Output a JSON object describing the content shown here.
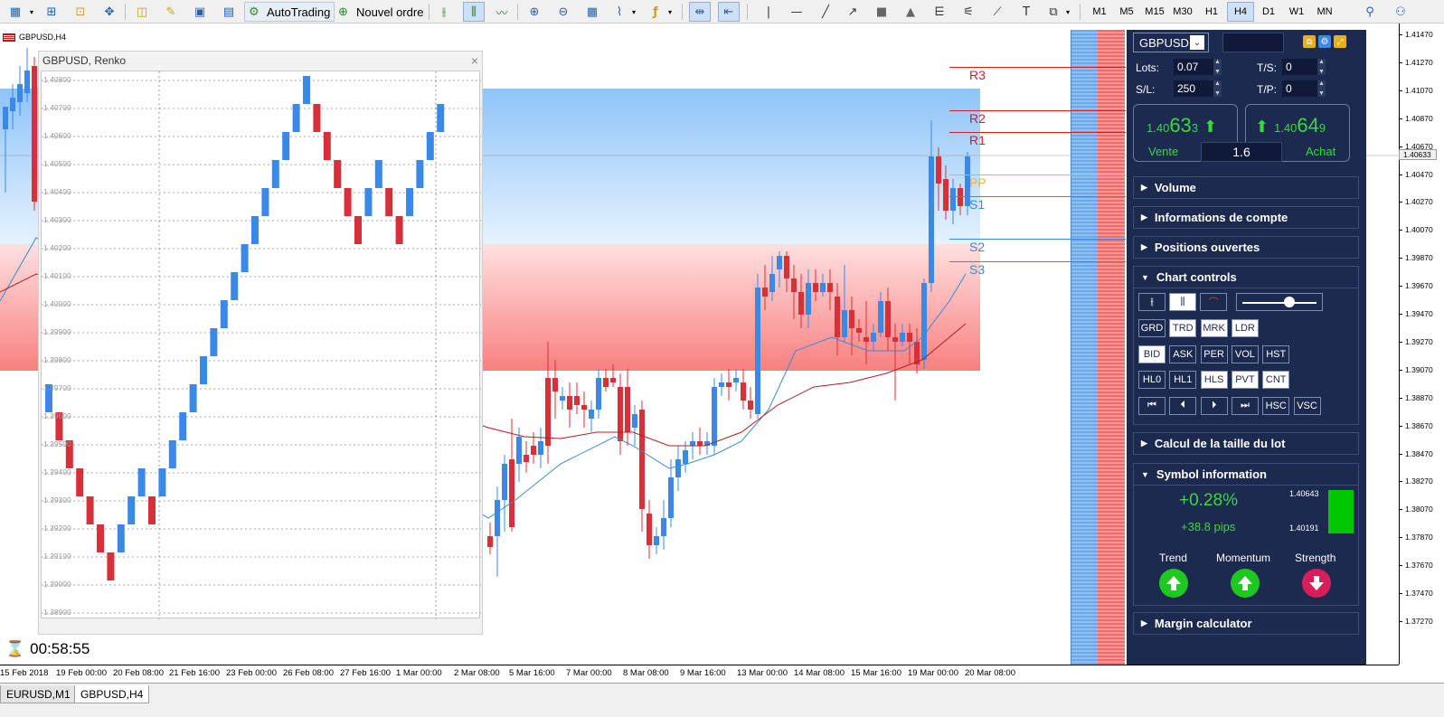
{
  "toolbar": {
    "autotrading_label": "AutoTrading",
    "new_order_label": "Nouvel ordre",
    "timeframes": [
      "M1",
      "M5",
      "M15",
      "M30",
      "H1",
      "H4",
      "D1",
      "W1",
      "MN"
    ],
    "active_timeframe": "H4"
  },
  "chart": {
    "title": "GBPUSD,H4",
    "current_price": "1.40633",
    "price_labels": [
      "1.41470",
      "1.41270",
      "1.41070",
      "1.40870",
      "1.40670",
      "1.40470",
      "1.40270",
      "1.40070",
      "1.39870",
      "1.39670",
      "1.39470",
      "1.39270",
      "1.39070",
      "1.38870",
      "1.38670",
      "1.38470",
      "1.38270",
      "1.38070",
      "1.37870",
      "1.37670",
      "1.37470",
      "1.37270"
    ],
    "time_labels": [
      "15 Feb 2018",
      "19 Feb 00:00",
      "20 Feb 08:00",
      "21 Feb 16:00",
      "23 Feb 00:00",
      "26 Feb 08:00",
      "27 Feb 16:00",
      "1 Mar 00:00",
      "2 Mar 08:00",
      "5 Mar 16:00",
      "7 Mar 00:00",
      "8 Mar 08:00",
      "9 Mar 16:00",
      "13 Mar 00:00",
      "14 Mar 08:00",
      "15 Mar 16:00",
      "19 Mar 00:00",
      "20 Mar 08:00"
    ],
    "pivots": [
      {
        "name": "R3",
        "color": "#cc2222"
      },
      {
        "name": "R2",
        "color": "#cc2222"
      },
      {
        "name": "R1",
        "color": "#cc2222"
      },
      {
        "name": "PP",
        "color": "#e8b048"
      },
      {
        "name": "S1",
        "color": "#3a88d8"
      },
      {
        "name": "S2",
        "color": "#3a88d8"
      },
      {
        "name": "S3",
        "color": "#3a88d8"
      }
    ],
    "timer": "00:58:55",
    "colors": {
      "bull": "#3a88e8",
      "bear": "#d8303a",
      "ma_fast": "#3a88d8",
      "ma_slow": "#b02020"
    }
  },
  "renko": {
    "title": "GBPUSD, Renko",
    "close_label": "×",
    "price_labels": [
      "1.40800",
      "1.40700",
      "1.40600",
      "1.40500",
      "1.40400",
      "1.40300",
      "1.40200",
      "1.40100",
      "1.40000",
      "1.39900",
      "1.39800",
      "1.39700",
      "1.39600",
      "1.39500",
      "1.39400",
      "1.39300",
      "1.39200",
      "1.39100",
      "1.39000",
      "1.38900"
    ]
  },
  "tabs": [
    "EURUSD,M1",
    "GBPUSD,H4"
  ],
  "active_tab": "GBPUSD,H4",
  "panel": {
    "symbol": "GBPUSD",
    "lots_label": "Lots:",
    "lots_value": "0.07",
    "sl_label": "S/L:",
    "sl_value": "250",
    "ts_label": "T/S:",
    "ts_value": "0",
    "tp_label": "T/P:",
    "tp_value": "0",
    "sell_price_prefix": "1.40",
    "sell_price_big": "63",
    "sell_price_small": "3",
    "buy_price_prefix": "1.40",
    "buy_price_big": "64",
    "buy_price_small": "9",
    "sell_label": "Vente",
    "buy_label": "Achat",
    "spread": "1.6",
    "sections": {
      "volume": "Volume",
      "account": "Informations de compte",
      "positions": "Positions ouvertes",
      "chart_controls": "Chart controls",
      "lot_calc": "Calcul de la taille du lot",
      "symbol_info": "Symbol information",
      "margin": "Margin calculator"
    },
    "control_rows": [
      [
        "GRD",
        "TRD",
        "MRK",
        "LDR"
      ],
      [
        "BID",
        "ASK",
        "PER",
        "VOL",
        "HST"
      ],
      [
        "HL0",
        "HL1",
        "HLS",
        "PVT",
        "CNT"
      ],
      [
        "⏮",
        "⏴",
        "⏵",
        "⏭",
        "HSC",
        "VSC"
      ]
    ],
    "active_controls": [
      "TRD",
      "MRK",
      "LDR",
      "BID",
      "HLS",
      "PVT",
      "CNT"
    ],
    "symbol_info": {
      "change_pct": "+0.28%",
      "change_pips": "+38.8 pips",
      "high": "1.40643",
      "low": "1.40191",
      "trend_label": "Trend",
      "momentum_label": "Momentum",
      "strength_label": "Strength",
      "trend_dir": "up",
      "momentum_dir": "up",
      "strength_dir": "down"
    }
  }
}
